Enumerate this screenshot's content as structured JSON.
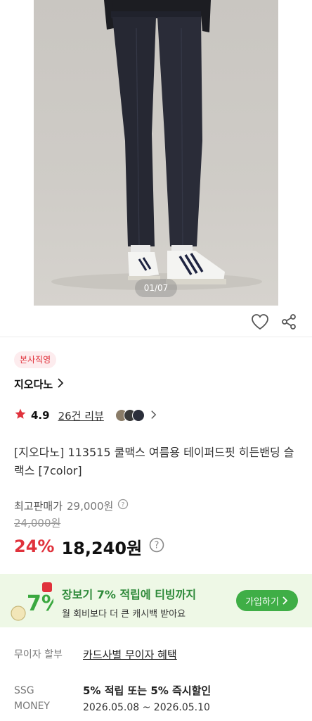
{
  "gallery": {
    "indicator": "01/07"
  },
  "icons": {
    "heart": "heart-icon",
    "share": "share-icon",
    "star": "star-icon",
    "chevron": "chevron-right-icon",
    "info": "info-icon"
  },
  "colors": {
    "accent_red": "#e0323c",
    "promo_green": "#3fae46",
    "promo_bg": "#eef8e6"
  },
  "badge": "본사직영",
  "brand": "지오다노",
  "rating": {
    "value": "4.9",
    "reviews": "26건 리뷰"
  },
  "product_title": "[지오다노] 113515 쿨맥스 여름용 테이퍼드핏 히든밴딩 슬랙스 [7color]",
  "price": {
    "max_label": "최고판매가",
    "max_value": "29,000원",
    "original": "24,000원",
    "discount": "24%",
    "sale": "18,240원"
  },
  "promo": {
    "logo_text": "7%",
    "title": "장보기 7% 적립에 티빙까지",
    "subtitle": "월 회비보다 더 큰 캐시백 받아요",
    "button": "가입하기"
  },
  "installment": {
    "label": "무이자 할부",
    "link": "카드사별 무이자 혜택"
  },
  "ssg_money": {
    "label_line1": "SSG",
    "label_line2": "MONEY",
    "benefit": "5% 적립 또는 5% 즉시할인",
    "period": "2026.05.08 ~ 2026.05.10"
  }
}
